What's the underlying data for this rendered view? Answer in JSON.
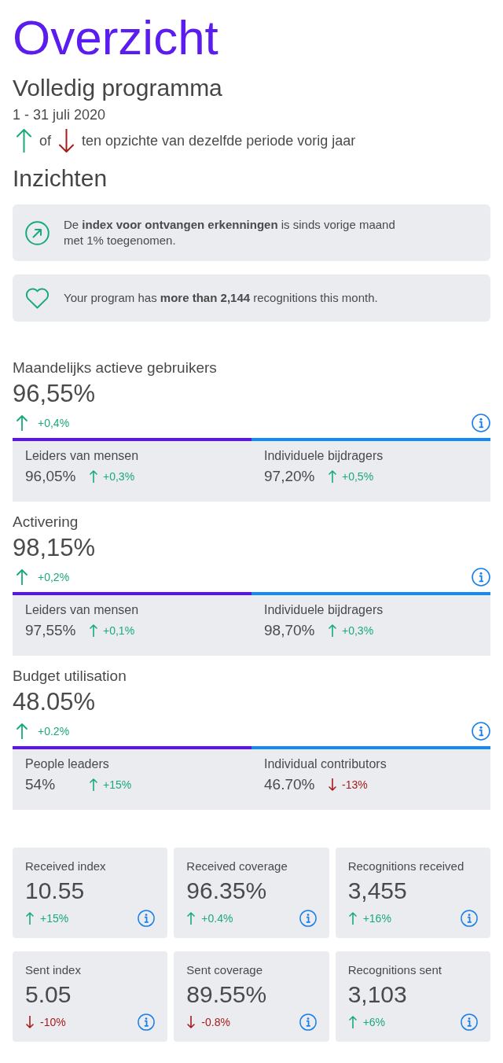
{
  "header": {
    "title": "Overzicht",
    "subtitle": "Volledig programma",
    "period": "1 - 31 juli 2020"
  },
  "legend": {
    "connector": "of",
    "description": "ten opzichte van dezelfde periode vorig jaar"
  },
  "insights": {
    "title": "Inzichten",
    "items": [
      {
        "kind": "trend",
        "text": "De **index voor ontvangen erkenningen** is sinds vorige maand met 1% toegenomen."
      },
      {
        "kind": "heart",
        "text": "Your program has **more than 2,144** recognitions this month."
      }
    ]
  },
  "metrics": [
    {
      "title": "Maandelijks actieve gebruikers",
      "value": "96,55%",
      "increase": true,
      "change": "+0,4%",
      "segments": [
        {
          "label": "Leiders van mensen",
          "value": "96,05%",
          "increase": true,
          "change": "+0,3%",
          "color": "#5b12f0"
        },
        {
          "label": "Individuele bijdragers",
          "value": "97,20%",
          "increase": true,
          "change": "+0,5%",
          "color": "#1589f5"
        }
      ]
    },
    {
      "title": "Activering",
      "value": "98,15%",
      "increase": true,
      "change": "+0,2%",
      "segments": [
        {
          "label": "Leiders van mensen",
          "value": "97,55%",
          "increase": true,
          "change": "+0,1%",
          "color": "#5b12f0"
        },
        {
          "label": "Individuele bijdragers",
          "value": "98,70%",
          "increase": true,
          "change": "+0,3%",
          "color": "#1589f5"
        }
      ]
    },
    {
      "title": "Budget utilisation",
      "value": "48.05%",
      "increase": true,
      "change": "+0.2%",
      "segments": [
        {
          "label": "People leaders",
          "value": "54%",
          "increase": true,
          "change": "+15%",
          "color": "#5b12f0"
        },
        {
          "label": "Individual contributors",
          "value": "46.70%",
          "increase": false,
          "change": "-13%",
          "color": "#1589f5"
        }
      ]
    }
  ],
  "stats": [
    {
      "label": "Received index",
      "value": "10.55",
      "increase": true,
      "change": "+15%"
    },
    {
      "label": "Received coverage",
      "value": "96.35%",
      "increase": true,
      "change": "+0.4%"
    },
    {
      "label": "Recognitions received",
      "value": "3,455",
      "increase": true,
      "change": "+16%"
    },
    {
      "label": "Sent index",
      "value": "5.05",
      "increase": false,
      "change": "-10%"
    },
    {
      "label": "Sent coverage",
      "value": "89.55%",
      "increase": false,
      "change": "-0.8%"
    },
    {
      "label": "Recognitions sent",
      "value": "3,103",
      "increase": true,
      "change": "+6%"
    }
  ]
}
